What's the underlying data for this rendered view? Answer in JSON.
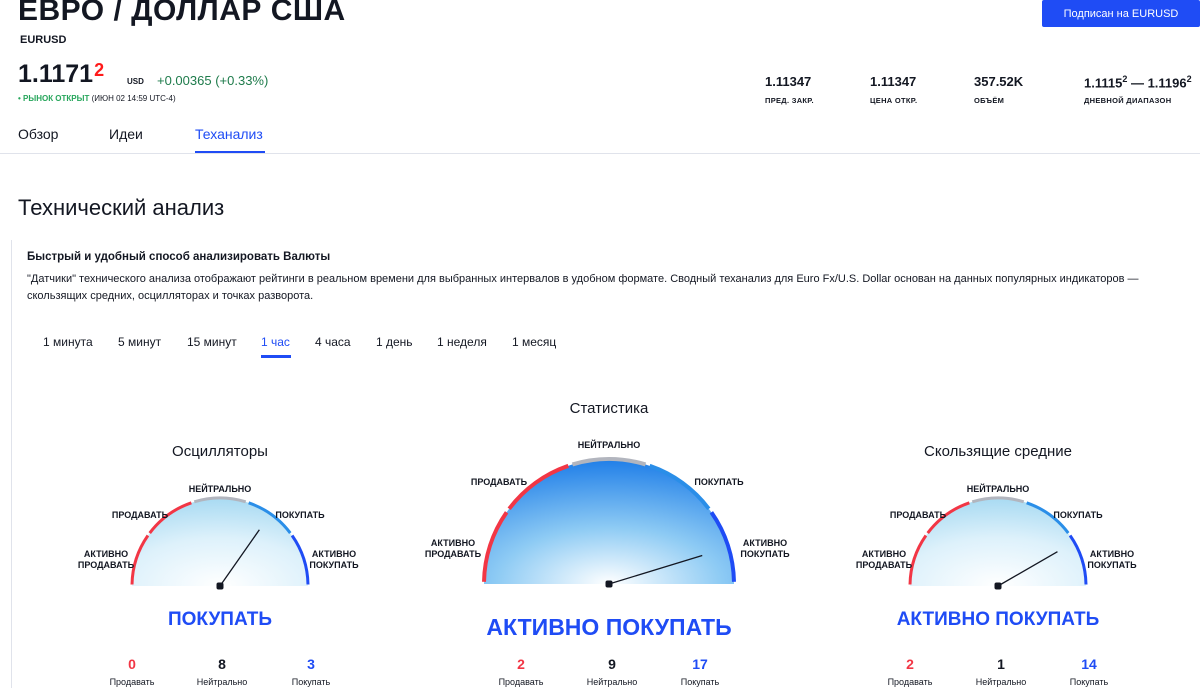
{
  "header": {
    "title": "ЕВРО / ДОЛЛАР США",
    "ticker": "EURUSD",
    "subscribe_label": "Подписан на EURUSD",
    "price_main": "1.1171",
    "price_sup": "2",
    "currency": "USD",
    "change": "+0.00365 (+0.33%)",
    "market_open": "• РЫНОК ОТКРЫТ",
    "market_time": "(ИЮН 02 14:59 UTC-4)"
  },
  "stats": [
    {
      "value": "1.11347",
      "label": "ПРЕД. ЗАКР."
    },
    {
      "value": "1.11347",
      "label": "ЦЕНА ОТКР."
    },
    {
      "value": "357.52K",
      "label": "ОБЪЁМ"
    },
    {
      "value_a": "1.1115",
      "sup_a": "2",
      "dash": " — ",
      "value_b": "1.1196",
      "sup_b": "2",
      "label": "ДНЕВНОЙ ДИАПАЗОН"
    }
  ],
  "tabs": [
    "Обзор",
    "Идеи",
    "Теханализ"
  ],
  "section_title": "Технический анализ",
  "intro": {
    "title": "Быстрый и удобный способ анализировать Валюты",
    "text": "\"Датчики\" технического анализа отображают рейтинги в реальном времени для выбранных интервалов в удобном формате. Сводный теханализ для Euro Fx/U.S. Dollar основан на данных популярных индикаторов — скользящих средних, осцилляторах и точках разворота."
  },
  "intervals": [
    "1 минута",
    "5 минут",
    "15 минут",
    "1 час",
    "4 часа",
    "1 день",
    "1 неделя",
    "1 месяц"
  ],
  "gauge_labels": {
    "strong_sell_1": "АКТИВНО",
    "strong_sell_2": "ПРОДАВАТЬ",
    "sell": "ПРОДАВАТЬ",
    "neutral": "НЕЙТРАЛЬНО",
    "buy": "ПОКУПАТЬ",
    "strong_buy_1": "АКТИВНО",
    "strong_buy_2": "ПОКУПАТЬ"
  },
  "count_labels": {
    "sell": "Продавать",
    "neutral": "Нейтрально",
    "buy": "Покупать"
  },
  "gauges": [
    {
      "title": "Осцилляторы",
      "verdict": "ПОКУПАТЬ",
      "needle_deg": 35,
      "sell": "0",
      "neutral": "8",
      "buy": "3"
    },
    {
      "title": "Статистика",
      "verdict": "АКТИВНО ПОКУПАТЬ",
      "needle_deg": 73,
      "sell": "2",
      "neutral": "9",
      "buy": "17"
    },
    {
      "title": "Скользящие средние",
      "verdict": "АКТИВНО ПОКУПАТЬ",
      "needle_deg": 60,
      "sell": "2",
      "neutral": "1",
      "buy": "14"
    }
  ],
  "colors": {
    "accent": "#1f4cf5",
    "sell": "#f23645",
    "positive": "#1e7b4b",
    "neutral_arc": "#b2b5be"
  }
}
